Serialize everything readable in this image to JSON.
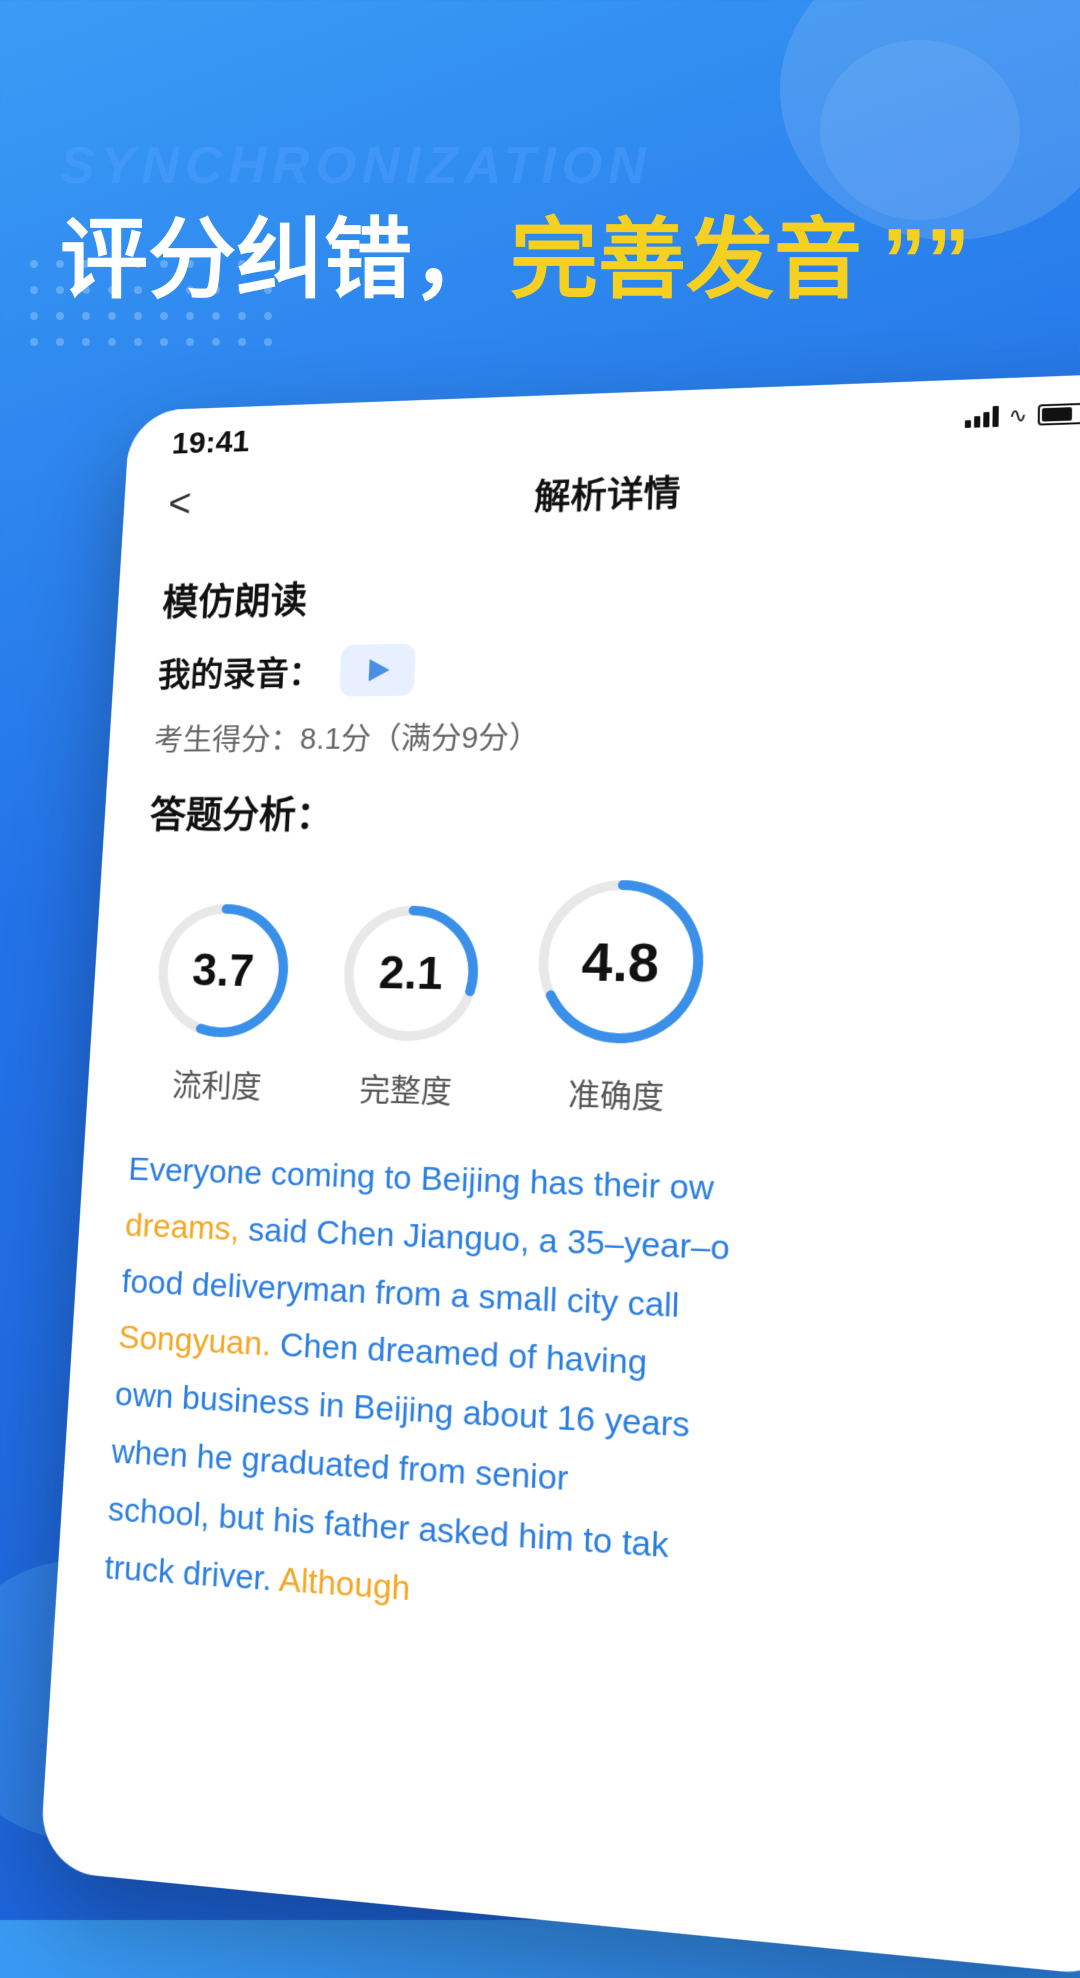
{
  "background": {
    "sync_text": "SYNCHRONIZATION",
    "headline_part1": "评分纠错，",
    "headline_part2": "完善发音",
    "quote_mark": "””"
  },
  "status_bar": {
    "time": "19:41"
  },
  "nav": {
    "back_label": "<",
    "title": "解析详情"
  },
  "content": {
    "section_title": "模仿朗读",
    "recording_label": "我的录音：",
    "score_text": "考生得分：8.1分（满分9分）",
    "analysis_title": "答题分析：",
    "fluency_value": "3.7",
    "fluency_label": "流利度",
    "completeness_value": "2.1",
    "completeness_label": "完整度",
    "accuracy_value": "4.8",
    "accuracy_label": "准确度",
    "passage_line1": "Everyone coming to Beijing has their ow",
    "passage_line2": "dreams, said Chen Jianguo, a 35-year-o",
    "passage_line3": "food deliveryman from a small city call",
    "passage_line4": "Songyuan. Chen dreamed of having",
    "passage_line5": "own business in Beijing about 16 years",
    "passage_line6": "he graduated from senior",
    "passage_line7": "when he graduated from senior",
    "passage_line8": "school, but his father asked him to tak",
    "passage_line9": "truck driver. Although"
  }
}
